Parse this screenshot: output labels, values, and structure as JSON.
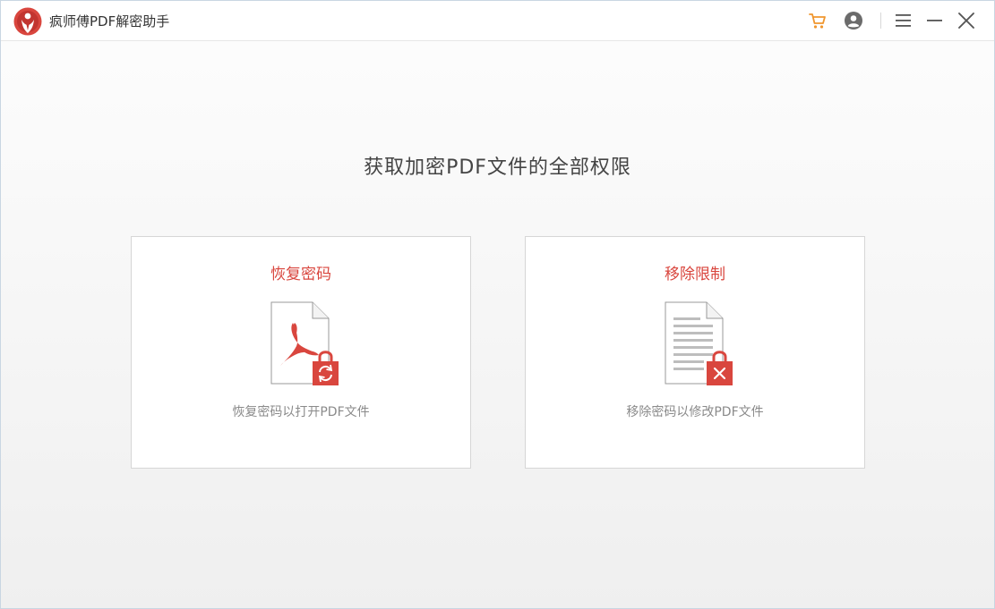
{
  "app": {
    "title": "疯师傅PDF解密助手"
  },
  "titlebar": {
    "icons": [
      "cart-icon",
      "user-icon",
      "menu-icon",
      "minimize-icon",
      "close-icon"
    ]
  },
  "main": {
    "headline": "获取加密PDF文件的全部权限",
    "cards": [
      {
        "title": "恢复密码",
        "description": "恢复密码以打开PDF文件",
        "icon": "pdf-unlock-icon"
      },
      {
        "title": "移除限制",
        "description": "移除密码以修改PDF文件",
        "icon": "document-remove-lock-icon"
      }
    ]
  },
  "colors": {
    "accent": "#d9463e",
    "cart": "#f0962e",
    "icon_gray": "#555555"
  }
}
